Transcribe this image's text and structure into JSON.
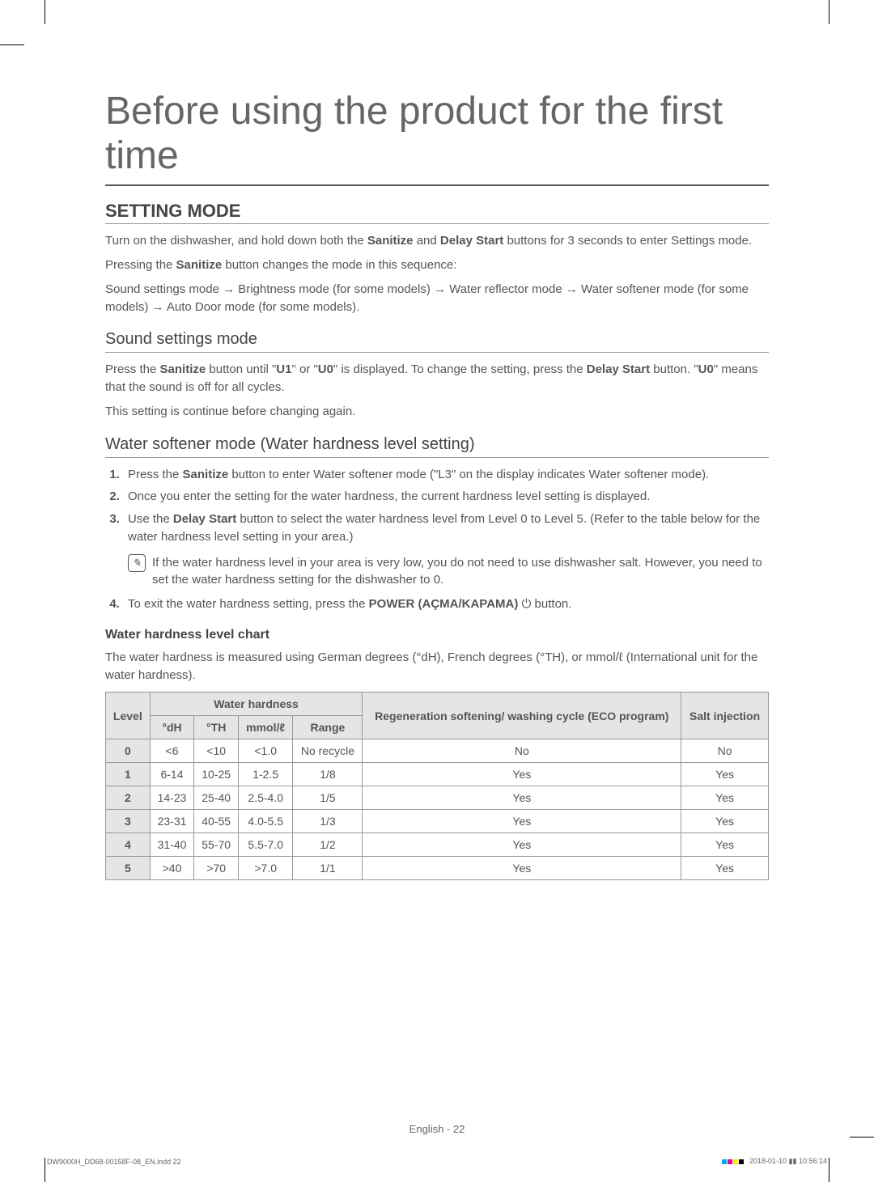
{
  "title": "Before using the product for the first time",
  "section1": {
    "heading": "SETTING MODE",
    "para1_pre": "Turn on the dishwasher, and hold down both the ",
    "para1_b1": "Sanitize",
    "para1_mid": " and ",
    "para1_b2": "Delay Start",
    "para1_post": " buttons for 3 seconds to enter Settings mode.",
    "para2_pre": "Pressing the ",
    "para2_b": "Sanitize",
    "para2_post": " button changes the mode in this sequence:",
    "para3": "Sound settings mode → Brightness mode (for some models) → Water reflector mode → Water softener mode (for some models) → Auto Door mode (for some models)."
  },
  "section2": {
    "heading": "Sound settings mode",
    "para1_pre": "Press the ",
    "para1_b1": "Sanitize",
    "para1_mid1": " button until \"",
    "para1_b2": "U1",
    "para1_mid2": "\" or \"",
    "para1_b3": "U0",
    "para1_mid3": "\" is displayed. To change the setting, press the ",
    "para1_b4": "Delay Start",
    "para1_mid4": " button. \"",
    "para1_b5": "U0",
    "para1_post": "\" means that the sound is off for all cycles.",
    "para2": "This setting is continue before changing again."
  },
  "section3": {
    "heading": "Water softener mode (Water hardness level setting)",
    "li1_pre": "Press the ",
    "li1_b": "Sanitize",
    "li1_post": " button to enter Water softener mode (\"L3\" on the display indicates Water softener mode).",
    "li2": "Once you enter the setting for the water hardness, the current hardness level setting is displayed.",
    "li3_pre": "Use the ",
    "li3_b": "Delay Start",
    "li3_post": " button to select the water hardness level from Level 0 to Level 5. (Refer to the table below for the water hardness level setting in your area.)",
    "note": "If the water hardness level in your area is very low, you do not need to use dishwasher salt. However, you need to set the water hardness setting for the dishwasher to 0.",
    "li4_pre": "To exit the water hardness setting, press the ",
    "li4_b": "POWER (AÇMA/KAPAMA)",
    "li4_post": " ⏻ button."
  },
  "chart_section": {
    "heading": "Water hardness level chart",
    "para": "The water hardness is measured using German degrees (°dH), French degrees (°TH), or mmol/ℓ (International unit for the water hardness)."
  },
  "chart_data": {
    "type": "table",
    "headers": {
      "level": "Level",
      "water_hardness": "Water hardness",
      "dh": "°dH",
      "th": "°TH",
      "mmol": "mmol/ℓ",
      "range": "Range",
      "regen": "Regeneration softening/ washing cycle (ECO program)",
      "salt": "Salt injection"
    },
    "rows": [
      {
        "level": "0",
        "dh": "<6",
        "th": "<10",
        "mmol": "<1.0",
        "range": "No recycle",
        "regen": "No",
        "salt": "No"
      },
      {
        "level": "1",
        "dh": "6-14",
        "th": "10-25",
        "mmol": "1-2.5",
        "range": "1/8",
        "regen": "Yes",
        "salt": "Yes"
      },
      {
        "level": "2",
        "dh": "14-23",
        "th": "25-40",
        "mmol": "2.5-4.0",
        "range": "1/5",
        "regen": "Yes",
        "salt": "Yes"
      },
      {
        "level": "3",
        "dh": "23-31",
        "th": "40-55",
        "mmol": "4.0-5.5",
        "range": "1/3",
        "regen": "Yes",
        "salt": "Yes"
      },
      {
        "level": "4",
        "dh": "31-40",
        "th": "55-70",
        "mmol": "5.5-7.0",
        "range": "1/2",
        "regen": "Yes",
        "salt": "Yes"
      },
      {
        "level": "5",
        "dh": ">40",
        "th": ">70",
        "mmol": ">7.0",
        "range": "1/1",
        "regen": "Yes",
        "salt": "Yes"
      }
    ]
  },
  "footer": {
    "center": "English - 22",
    "left": "DW9000H_DD68-00158F-08_EN.indd   22",
    "right": "2018-01-10   ▮▮ 10:56:14"
  }
}
